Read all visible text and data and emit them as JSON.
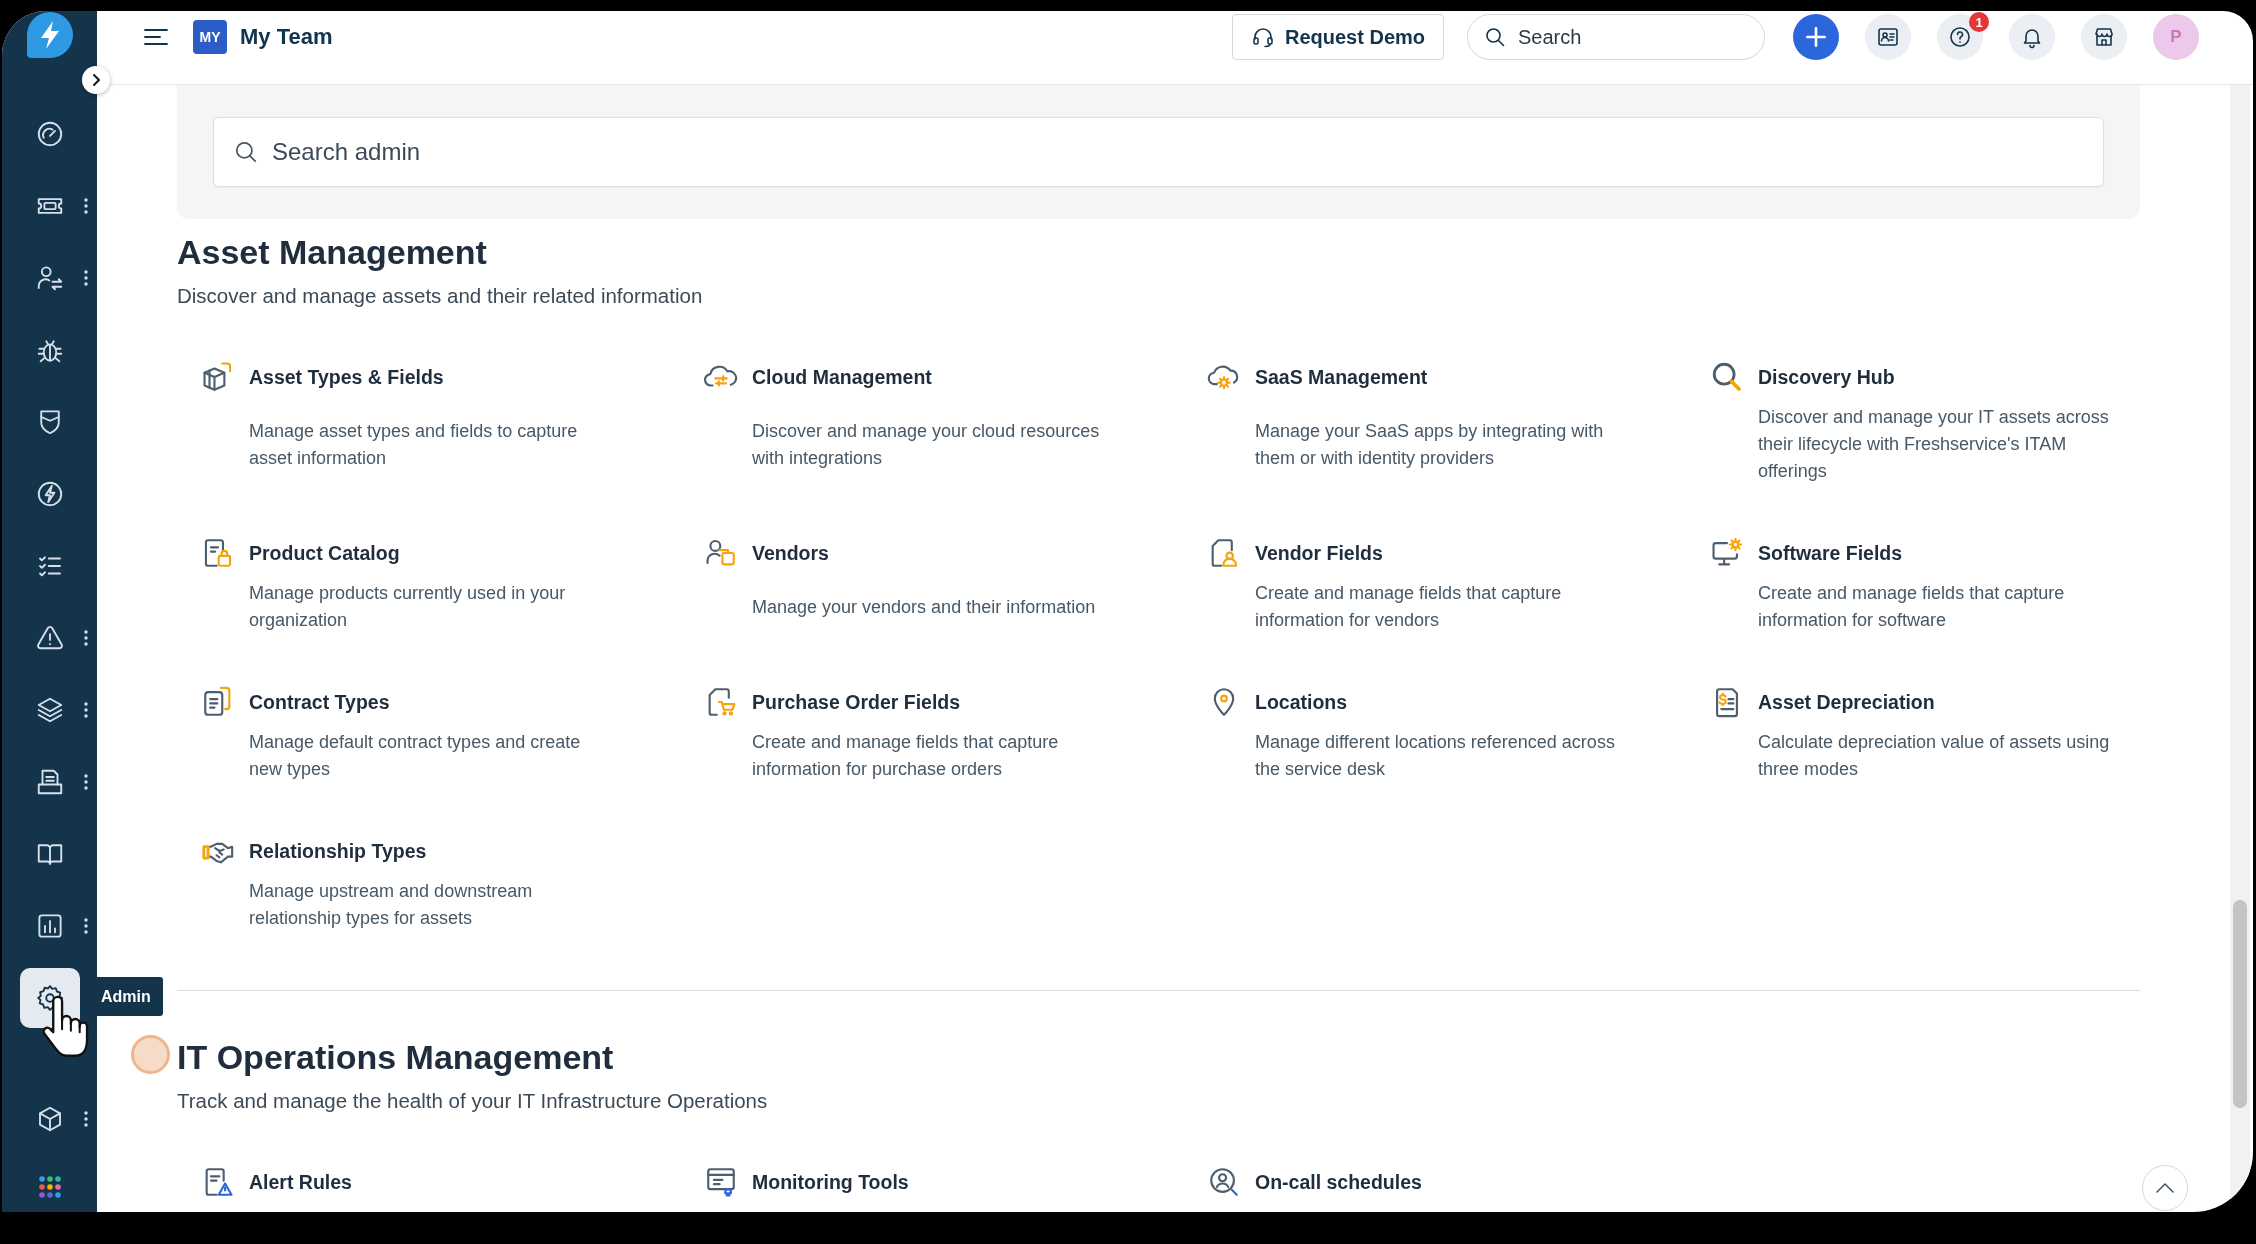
{
  "top_bar": {
    "workspace_badge": "MY",
    "workspace_name": "My Team",
    "request_demo": "Request Demo",
    "search": {
      "placeholder": "Search"
    },
    "help_badge": "1",
    "avatar_initial": "P"
  },
  "sidebar": {
    "items": [
      {
        "selected": false,
        "has_menu": false
      },
      {
        "selected": false,
        "has_menu": true
      },
      {
        "selected": false,
        "has_menu": true
      },
      {
        "selected": false,
        "has_menu": false
      },
      {
        "selected": false,
        "has_menu": false
      },
      {
        "selected": false,
        "has_menu": false
      },
      {
        "selected": false,
        "has_menu": false
      },
      {
        "selected": false,
        "has_menu": true
      },
      {
        "selected": false,
        "has_menu": true
      },
      {
        "selected": false,
        "has_menu": true
      },
      {
        "selected": false,
        "has_menu": false
      },
      {
        "selected": false,
        "has_menu": true
      },
      {
        "selected": true,
        "has_menu": false
      }
    ],
    "bottom_items": [
      {
        "selected": false,
        "has_menu": true
      }
    ],
    "tooltip": "Admin"
  },
  "admin_search": {
    "placeholder": "Search admin"
  },
  "sections": [
    {
      "title": "Asset Management",
      "description": "Discover and manage assets and their related information",
      "beacon": false,
      "items": [
        {
          "title": "Asset Types & Fields",
          "description": "Manage asset types and fields to capture asset information"
        },
        {
          "title": "Cloud Management",
          "description": "Discover and manage your cloud resources with integrations"
        },
        {
          "title": "SaaS Management",
          "description": "Manage your SaaS apps by integrating with them or with identity providers"
        },
        {
          "title": "Discovery Hub",
          "description": "Discover and manage your IT assets across their lifecycle with Freshservice's ITAM offerings"
        },
        {
          "title": "Product Catalog",
          "description": "Manage products currently used in your organization"
        },
        {
          "title": "Vendors",
          "description": "Manage your vendors and their information"
        },
        {
          "title": "Vendor Fields",
          "description": "Create and manage fields that capture information for vendors"
        },
        {
          "title": "Software Fields",
          "description": "Create and manage fields that capture information for software"
        },
        {
          "title": "Contract Types",
          "description": "Manage default contract types and create new types"
        },
        {
          "title": "Purchase Order Fields",
          "description": "Create and manage fields that capture information for purchase orders"
        },
        {
          "title": "Locations",
          "description": "Manage different locations referenced across the service desk"
        },
        {
          "title": "Asset Depreciation",
          "description": "Calculate depreciation value of assets using three modes"
        },
        {
          "title": "Relationship Types",
          "description": "Manage upstream and downstream relationship types for assets"
        }
      ]
    },
    {
      "title": "IT Operations Management",
      "description": "Track and manage the health of your IT Infrastructure Operations",
      "beacon": true,
      "items": [
        {
          "title": "Alert Rules"
        },
        {
          "title": "Monitoring Tools"
        },
        {
          "title": "On-call schedules"
        }
      ]
    }
  ]
}
